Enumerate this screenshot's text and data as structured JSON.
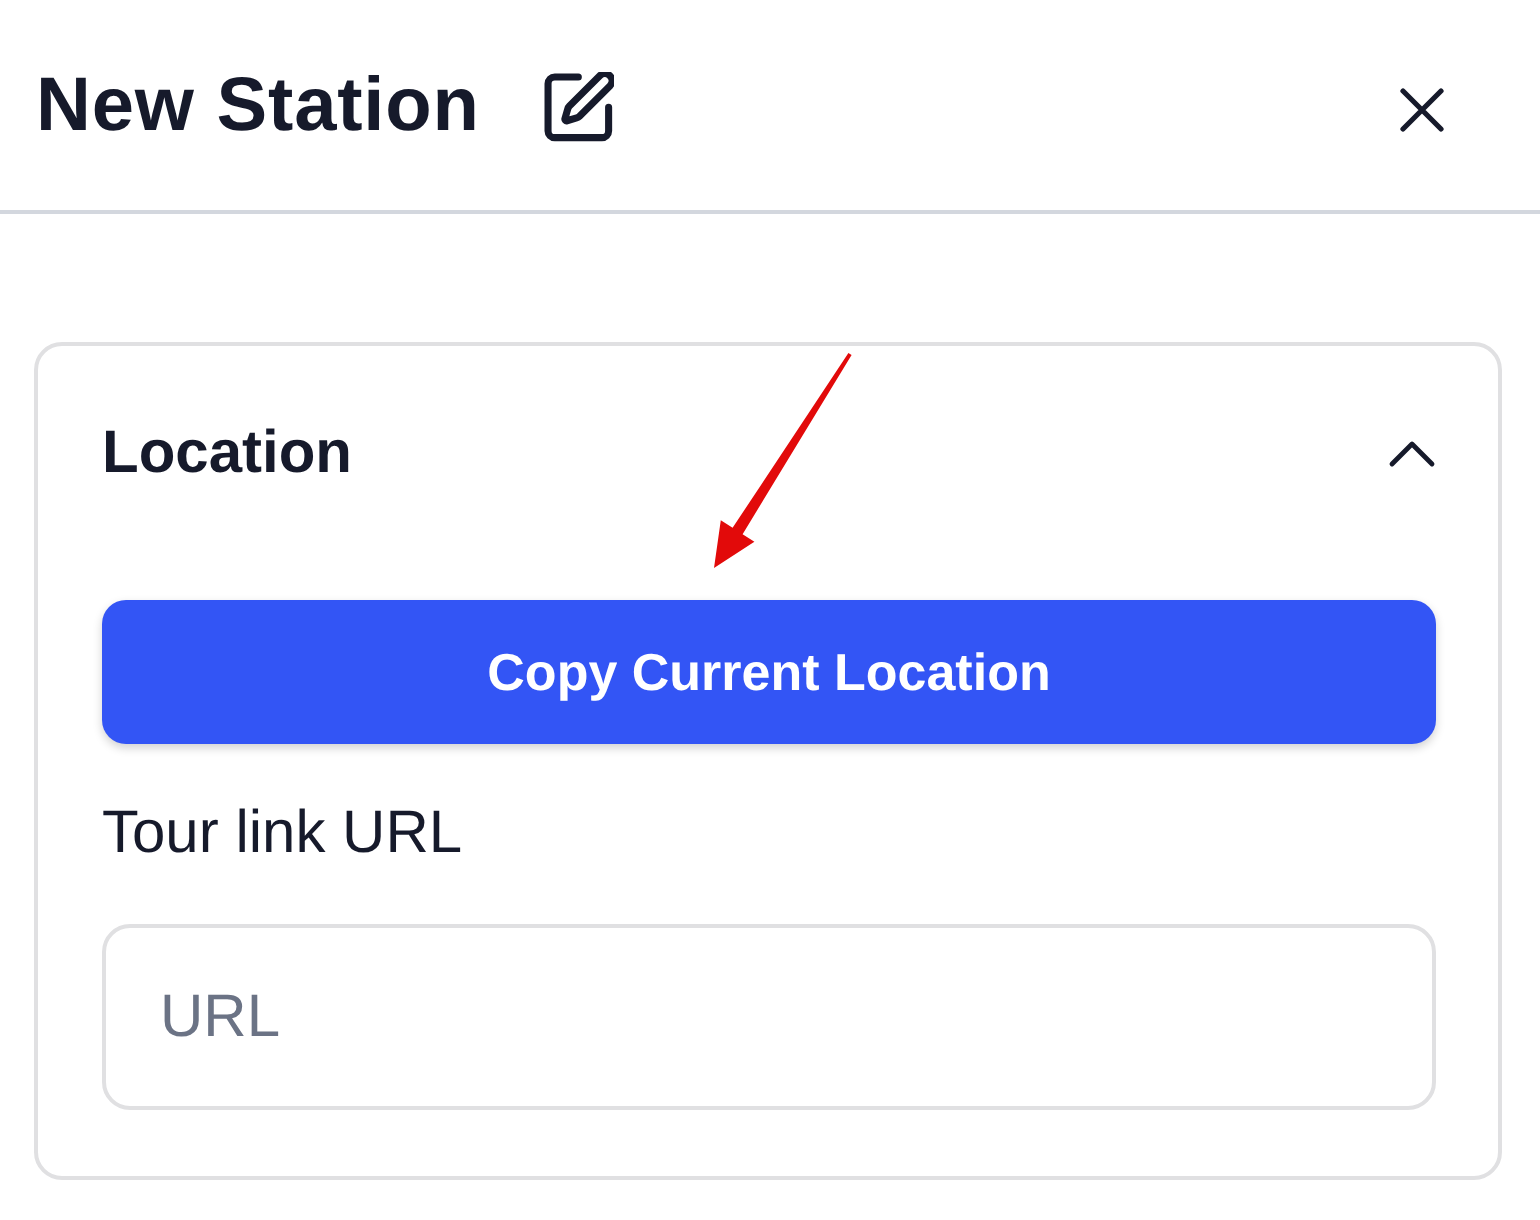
{
  "header": {
    "title": "New Station"
  },
  "section": {
    "title": "Location",
    "expanded": true,
    "button": {
      "label": "Copy Current Location"
    },
    "field": {
      "label": "Tour link URL",
      "placeholder": "URL"
    }
  }
}
